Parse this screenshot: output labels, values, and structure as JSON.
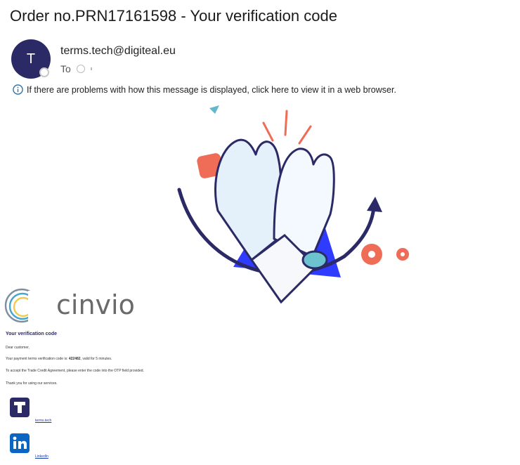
{
  "email": {
    "subject": "Order no.PRN17161598 - Your verification code",
    "avatar_letter": "T",
    "sender": "terms.tech@digiteal.eu",
    "to_label": "To",
    "info_message": "If there are problems with how this message is displayed, click here to view it in a web browser."
  },
  "body": {
    "brand": "cinvio",
    "heading": "Your verification code",
    "greeting": "Dear customer,",
    "code_text_before": "Your payment terms verification code is: ",
    "code": "422482",
    "code_text_after": ", valid for 5 minutes.",
    "instruction": "To accept the Trade Credit Agreement, please enter the code into the OTP field provided.",
    "thanks": "Thank you for using our services.",
    "links": [
      {
        "label": "terms.tech",
        "icon": "terms-tech-logo-icon"
      },
      {
        "label": "LinkedIn",
        "icon": "linkedin-icon"
      }
    ]
  },
  "colors": {
    "navy": "#2b2a66",
    "coral": "#ef6c56",
    "accent_blue": "#2f3cff"
  }
}
